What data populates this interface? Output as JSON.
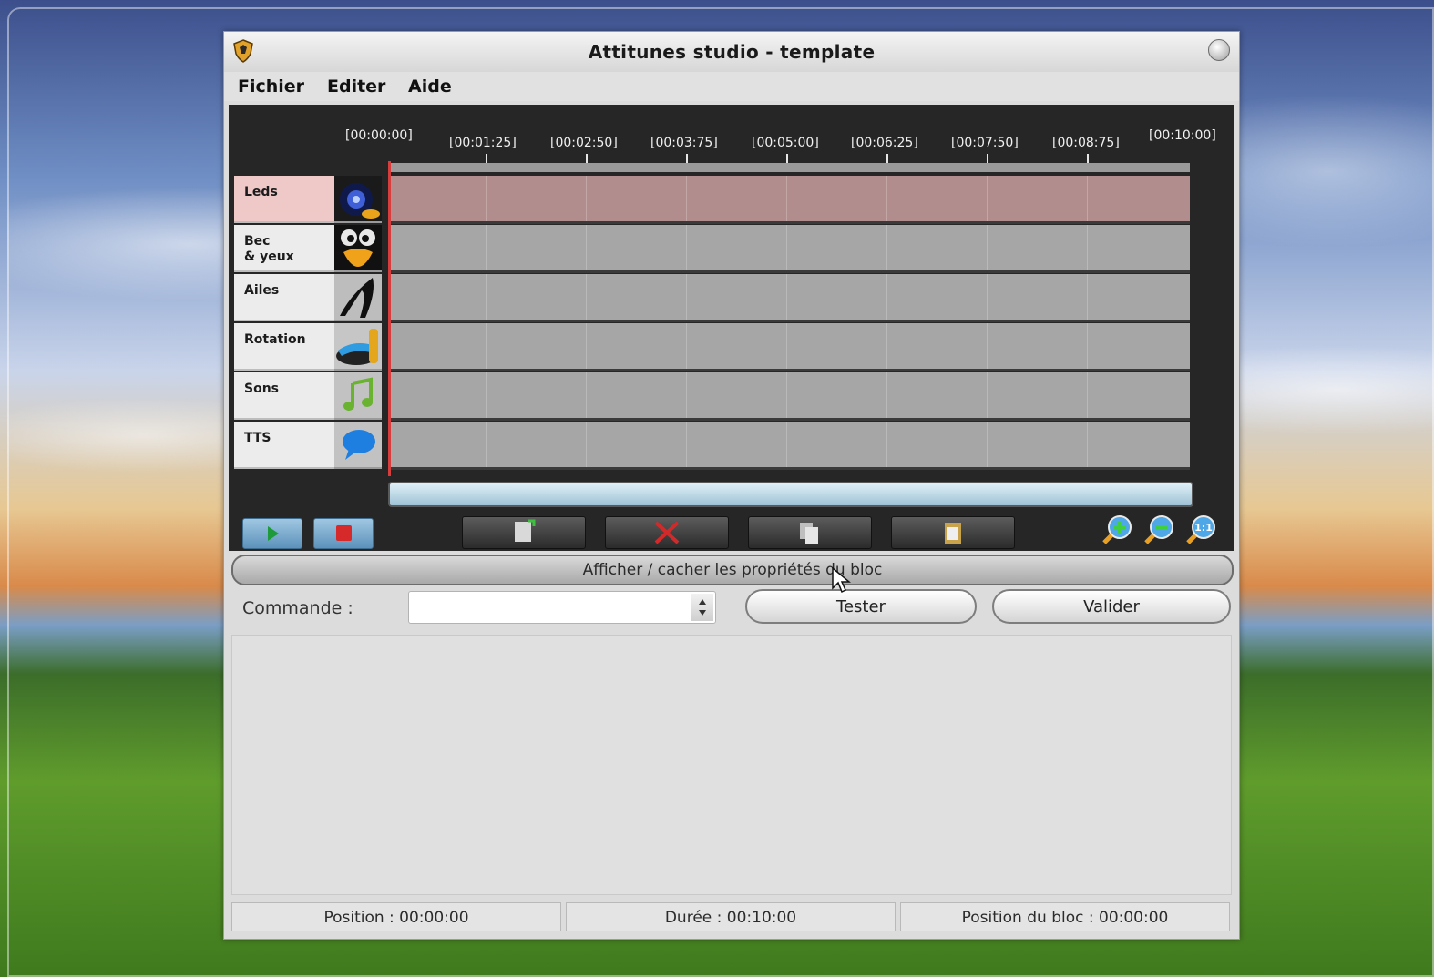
{
  "window": {
    "title": "Attitunes studio - template"
  },
  "menu": {
    "items": [
      "Fichier",
      "Editer",
      "Aide"
    ]
  },
  "timeline": {
    "ruler": [
      "[00:00:00]",
      "[00:01:25]",
      "[00:02:50]",
      "[00:03:75]",
      "[00:05:00]",
      "[00:06:25]",
      "[00:07:50]",
      "[00:08:75]",
      "[00:10:00]"
    ],
    "tracks": [
      {
        "label": "Leds",
        "icon": "leds-icon"
      },
      {
        "label": "Bec\n& yeux",
        "icon": "beak-eyes-icon"
      },
      {
        "label": "Ailes",
        "icon": "wings-icon"
      },
      {
        "label": "Rotation",
        "icon": "rotation-icon"
      },
      {
        "label": "Sons",
        "icon": "music-note-icon"
      },
      {
        "label": "TTS",
        "icon": "speech-bubble-icon"
      }
    ],
    "selected_track": "Leds",
    "colors": {
      "playhead": "#d63d3d",
      "selected_lane": "#b28d8d",
      "lane": "#a6a6a6"
    }
  },
  "properties": {
    "toggle_label": "Afficher / cacher les propriétés du bloc",
    "command_label": "Commande :",
    "command_value": "",
    "test_button": "Tester",
    "validate_button": "Valider"
  },
  "status": {
    "position": "Position : 00:00:00",
    "duration": "Durée : 00:10:00",
    "block_position": "Position du bloc : 00:00:00"
  }
}
